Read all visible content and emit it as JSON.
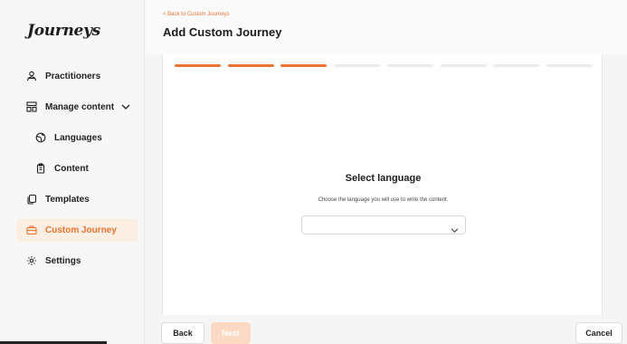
{
  "sidebar": {
    "logo": "Journeys",
    "items": [
      {
        "label": "Practitioners",
        "icon": "people-icon"
      },
      {
        "label": "Manage content",
        "icon": "content-grid-icon"
      },
      {
        "label": "Languages",
        "icon": "globe-icon"
      },
      {
        "label": "Content",
        "icon": "clipboard-icon"
      },
      {
        "label": "Templates",
        "icon": "copy-icon"
      },
      {
        "label": "Custom Journey",
        "icon": "briefcase-icon",
        "active": true
      },
      {
        "label": "Settings",
        "icon": "gear-icon"
      }
    ]
  },
  "header": {
    "back_link": "< Back to Custom Journeys",
    "title": "Add Custom Journey"
  },
  "progress": {
    "total_steps": 8,
    "completed_steps": 3
  },
  "main": {
    "title": "Select language",
    "subtitle": "Choose the language you will use to write the content.",
    "language_select": {
      "value": ""
    }
  },
  "footer": {
    "back_label": "Back",
    "next_label": "Next",
    "cancel_label": "Cancel"
  },
  "colors": {
    "accent": "#e9742f",
    "active_bg": "#fbeee2",
    "next_disabled": "#fbd9c2"
  }
}
